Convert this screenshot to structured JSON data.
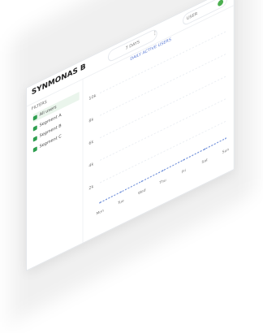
{
  "app": {
    "logo_text": "SYNMONAS",
    "logo_sub": "B"
  },
  "header": {
    "range_label": "7 DAYS",
    "separator": "⋮",
    "user_label": "USER",
    "avatar_color": "#4caf50"
  },
  "subtitle": "DAILY ACTIVE USERS",
  "sidebar": {
    "title": "FILTERS",
    "items": [
      {
        "label": "All users",
        "active": true
      },
      {
        "label": "Segment A",
        "active": false
      },
      {
        "label": "Segment B",
        "active": false
      },
      {
        "label": "Segment C",
        "active": false
      }
    ]
  },
  "chart_data": {
    "type": "line",
    "title": "",
    "xlabel": "",
    "ylabel": "",
    "y_ticks": [
      "10k",
      "8k",
      "6k",
      "4k",
      "2k"
    ],
    "x": [
      "Mon",
      "Tue",
      "Wed",
      "Thu",
      "Fri",
      "Sat",
      "Sun"
    ],
    "series": [
      {
        "values": [
          220,
          260,
          300,
          340,
          390,
          430,
          480
        ],
        "color": "#6b8cd9"
      }
    ],
    "ylim": [
      0,
      10000
    ],
    "grid": true
  }
}
